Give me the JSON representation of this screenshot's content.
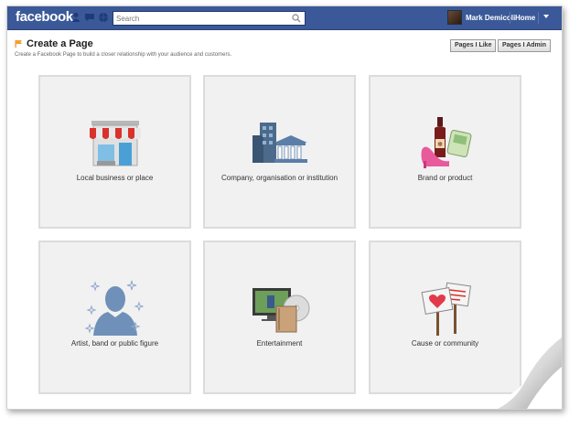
{
  "topbar": {
    "logo": "facebook",
    "search_placeholder": "Search",
    "user_name": "Mark Demicoli",
    "home_label": "Home"
  },
  "header": {
    "title": "Create a Page",
    "subtitle": "Create a Facebook Page to build a closer relationship with your audience and customers."
  },
  "buttons": {
    "pages_i_like": "Pages I Like",
    "pages_i_admin": "Pages I Admin"
  },
  "categories": [
    {
      "label": "Local business or place",
      "icon": "storefront-icon"
    },
    {
      "label": "Company, organisation or institution",
      "icon": "company-buildings-icon"
    },
    {
      "label": "Brand or product",
      "icon": "brand-products-icon"
    },
    {
      "label": "Artist, band or public figure",
      "icon": "public-figure-icon"
    },
    {
      "label": "Entertainment",
      "icon": "entertainment-icon"
    },
    {
      "label": "Cause or community",
      "icon": "cause-signs-icon"
    }
  ],
  "colors": {
    "topbar": "#3b5998",
    "tile_bg": "#f1f1f1",
    "tile_border": "#dcdcdc"
  }
}
